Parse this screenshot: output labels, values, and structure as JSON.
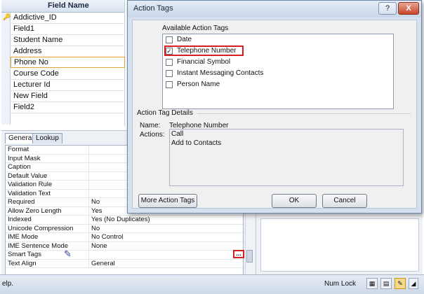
{
  "field_grid": {
    "header": "Field Name",
    "rows": [
      "Addictive_ID",
      "Field1",
      "Student Name",
      "Address",
      "Phone No",
      "Course Code",
      "Lecturer Id",
      "New Field",
      "Field2"
    ]
  },
  "properties": {
    "tabs": [
      "General",
      "Lookup"
    ],
    "rows": [
      {
        "label": "Format",
        "value": ""
      },
      {
        "label": "Input Mask",
        "value": ""
      },
      {
        "label": "Caption",
        "value": ""
      },
      {
        "label": "Default Value",
        "value": ""
      },
      {
        "label": "Validation Rule",
        "value": ""
      },
      {
        "label": "Validation Text",
        "value": ""
      },
      {
        "label": "Required",
        "value": "No"
      },
      {
        "label": "Allow Zero Length",
        "value": "Yes"
      },
      {
        "label": "Indexed",
        "value": "Yes (No Duplicates)"
      },
      {
        "label": "Unicode Compression",
        "value": "No"
      },
      {
        "label": "IME Mode",
        "value": "No Control"
      },
      {
        "label": "IME Sentence Mode",
        "value": "None"
      },
      {
        "label": "Smart Tags",
        "value": ""
      },
      {
        "label": "Text Align",
        "value": "General"
      }
    ],
    "smart_tags_button": "..."
  },
  "dialog": {
    "title": "Action Tags",
    "help_button": "?",
    "close_button": "X",
    "available_label": "Available Action Tags",
    "tags": [
      {
        "label": "Date",
        "checked": false
      },
      {
        "label": "Telephone Number",
        "checked": true
      },
      {
        "label": "Financial Symbol",
        "checked": false
      },
      {
        "label": "Instant Messaging Contacts",
        "checked": false
      },
      {
        "label": "Person Name",
        "checked": false
      }
    ],
    "details_label": "Action Tag Details",
    "name_label": "Name:",
    "name_value": "Telephone Number",
    "actions_label": "Actions:",
    "actions": [
      "Call",
      "Add to Contacts"
    ],
    "more_button": "More Action Tags",
    "ok_button": "OK",
    "cancel_button": "Cancel"
  },
  "statusbar": {
    "status_text": "elp.",
    "numlock": "Num Lock"
  },
  "colors": {
    "highlight": "#d61f1f",
    "dialog_bg": "#d6e1ef"
  }
}
